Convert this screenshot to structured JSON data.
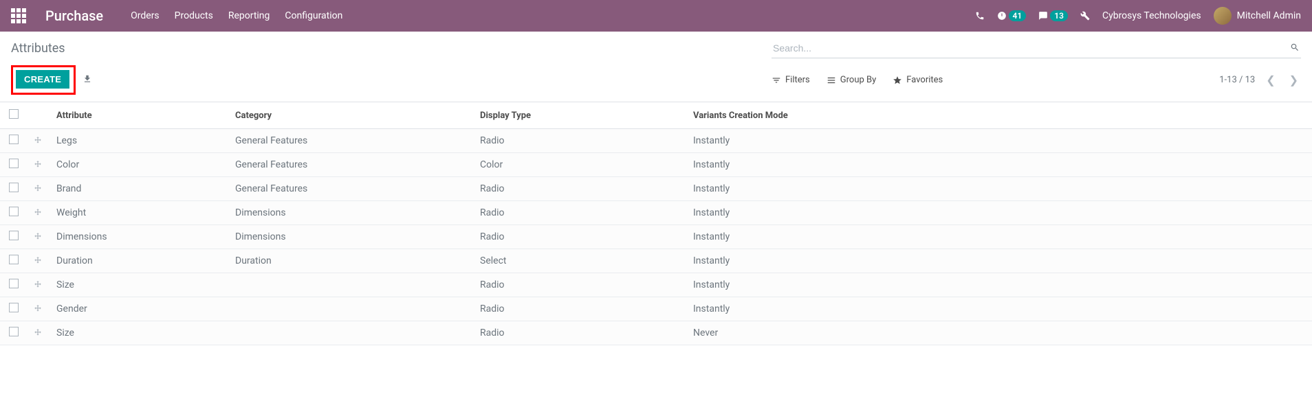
{
  "navbar": {
    "app_title": "Purchase",
    "menu": [
      "Orders",
      "Products",
      "Reporting",
      "Configuration"
    ],
    "activity_count": "41",
    "discuss_count": "13",
    "company": "Cybrosys Technologies",
    "user": "Mitchell Admin"
  },
  "breadcrumb": "Attributes",
  "search": {
    "placeholder": "Search..."
  },
  "toolbar": {
    "create_label": "CREATE",
    "filters_label": "Filters",
    "groupby_label": "Group By",
    "favorites_label": "Favorites"
  },
  "pager": {
    "range": "1-13 / 13"
  },
  "columns": {
    "attribute": "Attribute",
    "category": "Category",
    "display_type": "Display Type",
    "variants_mode": "Variants Creation Mode"
  },
  "rows": [
    {
      "attribute": "Legs",
      "category": "General Features",
      "display_type": "Radio",
      "variants_mode": "Instantly"
    },
    {
      "attribute": "Color",
      "category": "General Features",
      "display_type": "Color",
      "variants_mode": "Instantly"
    },
    {
      "attribute": "Brand",
      "category": "General Features",
      "display_type": "Radio",
      "variants_mode": "Instantly"
    },
    {
      "attribute": "Weight",
      "category": "Dimensions",
      "display_type": "Radio",
      "variants_mode": "Instantly"
    },
    {
      "attribute": "Dimensions",
      "category": "Dimensions",
      "display_type": "Radio",
      "variants_mode": "Instantly"
    },
    {
      "attribute": "Duration",
      "category": "Duration",
      "display_type": "Select",
      "variants_mode": "Instantly"
    },
    {
      "attribute": "Size",
      "category": "",
      "display_type": "Radio",
      "variants_mode": "Instantly"
    },
    {
      "attribute": "Gender",
      "category": "",
      "display_type": "Radio",
      "variants_mode": "Instantly"
    },
    {
      "attribute": "Size",
      "category": "",
      "display_type": "Radio",
      "variants_mode": "Never"
    }
  ]
}
